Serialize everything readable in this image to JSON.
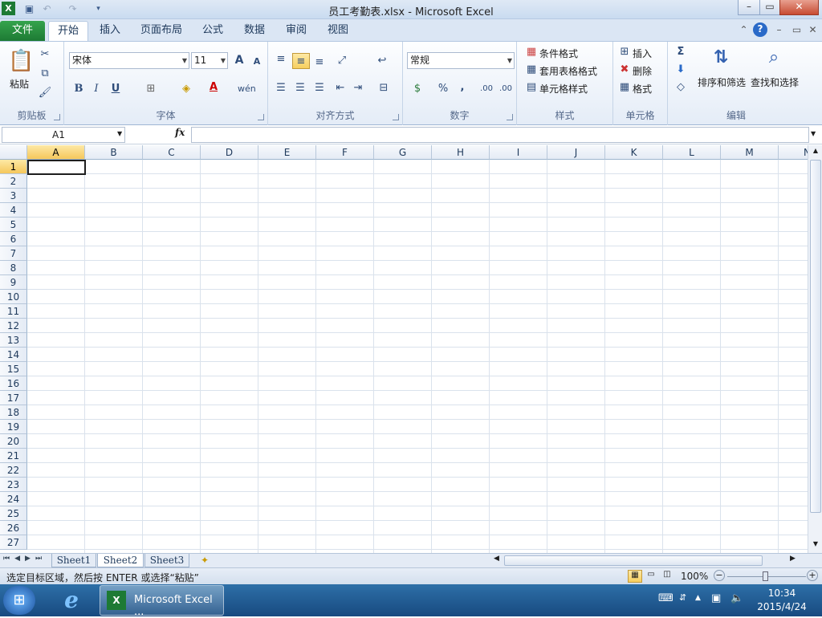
{
  "window": {
    "title": "员工考勤表.xlsx - Microsoft Excel",
    "min": "–",
    "max": "▭",
    "close": "✕"
  },
  "tabs": [
    "文件",
    "开始",
    "插入",
    "页面布局",
    "公式",
    "数据",
    "审阅",
    "视图"
  ],
  "ribbon": {
    "clipboard": {
      "group": "剪贴板",
      "paste": "粘贴"
    },
    "font": {
      "group": "字体",
      "name": "宋体",
      "size": "11",
      "bold": "B",
      "italic": "I",
      "underline": "U",
      "grow": "A",
      "shrink": "A",
      "fontcolor": "A"
    },
    "align": {
      "group": "对齐方式"
    },
    "number": {
      "group": "数字",
      "format": "常规",
      "percent": "%",
      "comma": ",",
      "inc": ".00",
      "dec": ".00"
    },
    "styles": {
      "group": "样式",
      "cond": "条件格式",
      "table": "套用表格格式",
      "cell": "单元格样式"
    },
    "cells": {
      "group": "单元格",
      "insert": "插入",
      "delete": "删除",
      "format": "格式"
    },
    "edit": {
      "group": "编辑",
      "sum": "Σ",
      "sort": "排序和筛选",
      "find": "查找和选择"
    }
  },
  "formula": {
    "namebox": "A1",
    "fx": "fx",
    "value": ""
  },
  "grid": {
    "columns": [
      "A",
      "B",
      "C",
      "D",
      "E",
      "F",
      "G",
      "H",
      "I",
      "J",
      "K",
      "L",
      "M",
      "N"
    ],
    "rows": [
      "1",
      "2",
      "3",
      "4",
      "5",
      "6",
      "7",
      "8",
      "9",
      "10",
      "11",
      "12",
      "13",
      "14",
      "15",
      "16",
      "17",
      "18",
      "19",
      "20",
      "21",
      "22",
      "23",
      "24",
      "25",
      "26",
      "27"
    ],
    "active": "A1"
  },
  "sheets": [
    "Sheet1",
    "Sheet2",
    "Sheet3"
  ],
  "status": {
    "message": "选定目标区域，然后按 ENTER 或选择“粘贴”",
    "zoom": "100%",
    "minus": "−",
    "plus": "+"
  },
  "taskbar": {
    "app": "Microsoft Excel ...",
    "time": "10:34",
    "date": "2015/4/24"
  },
  "colors": {
    "accent": "#1d7a34",
    "ribbon": "#dbe6f4",
    "taskbar": "#184a80"
  }
}
